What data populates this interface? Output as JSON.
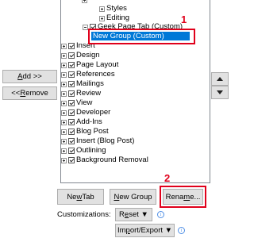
{
  "tree": {
    "items": [
      {
        "text": "Styles",
        "indent": 2,
        "expander": "plus",
        "checkbox": false
      },
      {
        "text": "Editing",
        "indent": 2,
        "expander": "plus",
        "checkbox": false
      },
      {
        "text": "Geek Page Tab (Custom)",
        "indent": 1,
        "expander": "minus",
        "checkbox": true
      },
      {
        "text": "New Group (Custom)",
        "indent": 3,
        "expander": "none",
        "checkbox": false,
        "selected": true
      },
      {
        "text": "Insert",
        "indent": 0,
        "expander": "plus",
        "checkbox": true
      },
      {
        "text": "Design",
        "indent": 0,
        "expander": "plus",
        "checkbox": true
      },
      {
        "text": "Page Layout",
        "indent": 0,
        "expander": "plus",
        "checkbox": true
      },
      {
        "text": "References",
        "indent": 0,
        "expander": "plus",
        "checkbox": true
      },
      {
        "text": "Mailings",
        "indent": 0,
        "expander": "plus",
        "checkbox": true
      },
      {
        "text": "Review",
        "indent": 0,
        "expander": "plus",
        "checkbox": true
      },
      {
        "text": "View",
        "indent": 0,
        "expander": "plus",
        "checkbox": true
      },
      {
        "text": "Developer",
        "indent": 0,
        "expander": "plus",
        "checkbox": true
      },
      {
        "text": "Add-Ins",
        "indent": 0,
        "expander": "plus",
        "checkbox": true
      },
      {
        "text": "Blog Post",
        "indent": 0,
        "expander": "plus",
        "checkbox": true
      },
      {
        "text": "Insert (Blog Post)",
        "indent": 0,
        "expander": "plus",
        "checkbox": true
      },
      {
        "text": "Outlining",
        "indent": 0,
        "expander": "plus",
        "checkbox": true
      },
      {
        "text": "Background Removal",
        "indent": 0,
        "expander": "plus",
        "checkbox": true
      }
    ]
  },
  "buttons": {
    "add": {
      "pre": "",
      "key": "A",
      "post": "dd >>"
    },
    "remove": {
      "pre": "<< ",
      "key": "R",
      "post": "emove"
    },
    "new_tab": {
      "pre": "Ne",
      "key": "w",
      "post": " Tab"
    },
    "new_group": {
      "pre": "",
      "key": "N",
      "post": "ew Group"
    },
    "rename": {
      "pre": "Rena",
      "key": "m",
      "post": "e..."
    },
    "reset": {
      "pre": "R",
      "key": "e",
      "post": "set ▼"
    },
    "import_export": {
      "pre": "Im",
      "key": "p",
      "post": "ort/Export ▼"
    }
  },
  "labels": {
    "customizations": "Customizations:"
  },
  "annotations": {
    "callout_1": "1",
    "callout_2": "2",
    "color": "#e0001b"
  },
  "icons": {
    "move_up": "triangle-up",
    "move_down": "triangle-down",
    "info": "info-circle"
  }
}
